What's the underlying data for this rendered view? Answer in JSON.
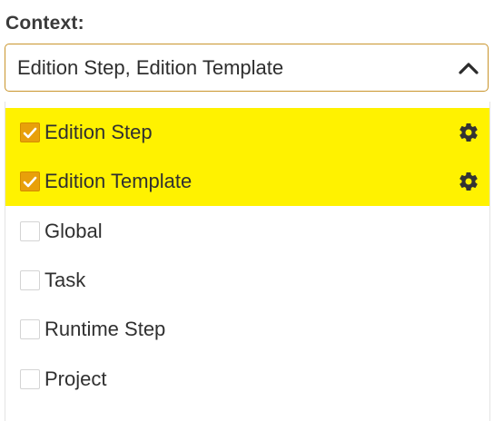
{
  "field": {
    "label": "Context:",
    "value": "Edition Step, Edition Template"
  },
  "options": [
    {
      "label": "Edition Step",
      "checked": true,
      "highlighted": true,
      "icon": "gear-icon"
    },
    {
      "label": "Edition Template",
      "checked": true,
      "highlighted": true,
      "icon": "gear-icon"
    },
    {
      "label": "Global",
      "checked": false,
      "highlighted": false
    },
    {
      "label": "Task",
      "checked": false,
      "highlighted": false
    },
    {
      "label": "Runtime Step",
      "checked": false,
      "highlighted": false
    },
    {
      "label": "Project",
      "checked": false,
      "highlighted": false
    }
  ],
  "colors": {
    "accent": "#e8a00a",
    "highlight": "#fff200",
    "border": "#c9952c"
  }
}
